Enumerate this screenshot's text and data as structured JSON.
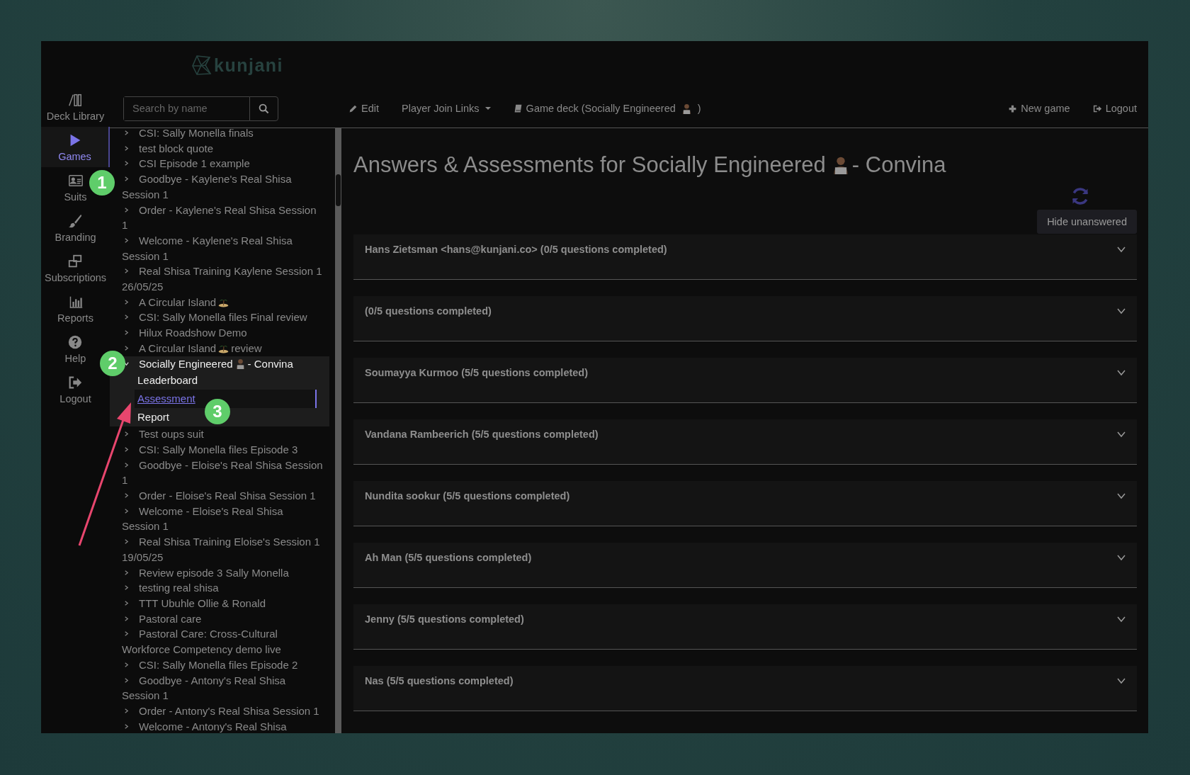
{
  "logo": "kunjani",
  "nav": [
    {
      "label": "Deck Library",
      "selected": false
    },
    {
      "label": "Games",
      "selected": true
    },
    {
      "label": "Suits",
      "selected": false
    },
    {
      "label": "Branding",
      "selected": false
    },
    {
      "label": "Subscriptions",
      "selected": false
    },
    {
      "label": "Reports",
      "selected": false
    },
    {
      "label": "Help",
      "selected": false
    },
    {
      "label": "Logout",
      "selected": false
    }
  ],
  "search": {
    "placeholder": "Search by name"
  },
  "toolbar": [
    {
      "label": "Edit",
      "kind": "edit"
    },
    {
      "label": "Player Join Links",
      "kind": "dropdown"
    },
    {
      "label": "Game deck (Socially Engineered",
      "after": ")",
      "kind": "deck"
    }
  ],
  "toolbar_right": [
    {
      "label": "New game"
    },
    {
      "label": "Logout"
    }
  ],
  "games": [
    {
      "label": "CSI: Sally Monella finals",
      "kind": "plain",
      "expanded": false
    },
    {
      "label": "test block quote",
      "kind": "plain",
      "expanded": false
    },
    {
      "label": "CSI Episode 1 example",
      "kind": "plain",
      "expanded": false
    },
    {
      "label": "Goodbye - Kaylene's Real Shisa Session 1",
      "kind": "plain",
      "expanded": false
    },
    {
      "label": "Order - Kaylene's Real Shisa Session 1",
      "kind": "plain",
      "expanded": false
    },
    {
      "label": "Welcome - Kaylene's Real Shisa Session 1",
      "kind": "plain",
      "expanded": false
    },
    {
      "label": "Real Shisa Training Kaylene Session 1 26/05/25",
      "kind": "plain",
      "expanded": false
    },
    {
      "label": "A Circular Island",
      "kind": "island",
      "expanded": false
    },
    {
      "label": "CSI: Sally Monella files Final review",
      "kind": "plain",
      "expanded": false
    },
    {
      "label": "Hilux Roadshow Demo",
      "kind": "plain",
      "expanded": false
    },
    {
      "label": "A Circular Island",
      "after": "review",
      "kind": "island",
      "expanded": false
    },
    {
      "label": "Socially Engineered",
      "after": "- Convina",
      "kind": "person",
      "expanded": true,
      "children": [
        {
          "label": "Leaderboard",
          "selected": false
        },
        {
          "label": "Assessment",
          "selected": true
        },
        {
          "label": "Report",
          "selected": false
        }
      ]
    },
    {
      "label": "Test oups suit",
      "kind": "plain",
      "expanded": false
    },
    {
      "label": "CSI: Sally Monella files Episode 3",
      "kind": "plain",
      "expanded": false
    },
    {
      "label": "Goodbye - Eloise's Real Shisa Session 1",
      "kind": "plain",
      "expanded": false
    },
    {
      "label": "Order - Eloise's Real Shisa Session 1",
      "kind": "plain",
      "expanded": false
    },
    {
      "label": "Welcome - Eloise's Real Shisa Session 1",
      "kind": "plain",
      "expanded": false
    },
    {
      "label": "Real Shisa Training Eloise's Session 1 19/05/25",
      "kind": "plain",
      "expanded": false
    },
    {
      "label": "Review episode 3 Sally Monella",
      "kind": "plain",
      "expanded": false
    },
    {
      "label": "testing real shisa",
      "kind": "plain",
      "expanded": false
    },
    {
      "label": "TTT Ubuhle Ollie & Ronald",
      "kind": "plain",
      "expanded": false
    },
    {
      "label": "Pastoral care",
      "kind": "plain",
      "expanded": false
    },
    {
      "label": "Pastoral Care: Cross-Cultural Workforce Competency demo live",
      "kind": "plain",
      "expanded": false
    },
    {
      "label": "CSI: Sally Monella files Episode 2",
      "kind": "plain",
      "expanded": false
    },
    {
      "label": "Goodbye - Antony's Real Shisa Session 1",
      "kind": "plain",
      "expanded": false
    },
    {
      "label": "Order - Antony's Real Shisa Session 1",
      "kind": "plain",
      "expanded": false
    },
    {
      "label": "Welcome - Antony's Real Shisa",
      "kind": "plain",
      "expanded": false
    }
  ],
  "page": {
    "title": "Answers & Assessments for Socially Engineered",
    "title_after": "- Convina",
    "hide_button": "Hide unanswered"
  },
  "players": [
    {
      "label": "Hans Zietsman <hans@kunjani.co> (0/5 questions completed)",
      "expanded": false
    },
    {
      "label": "(0/5 questions completed)",
      "expanded": false
    },
    {
      "label": "Soumayya Kurmoo (5/5 questions completed)",
      "expanded": false
    },
    {
      "label": "Vandana Rambeerich (5/5 questions completed)",
      "expanded": false
    },
    {
      "label": "Nundita sookur (5/5 questions completed)",
      "expanded": false
    },
    {
      "label": "Ah Man (5/5 questions completed)",
      "expanded": false
    },
    {
      "label": "Jenny (5/5 questions completed)",
      "expanded": false
    },
    {
      "label": "Nas (5/5 questions completed)",
      "expanded": false
    }
  ],
  "annotations": [
    {
      "label": "1",
      "kind": "badge"
    },
    {
      "label": "2",
      "kind": "badge"
    },
    {
      "label": "3",
      "kind": "badge"
    },
    {
      "kind": "arrow",
      "color": "#e8466e"
    }
  ]
}
